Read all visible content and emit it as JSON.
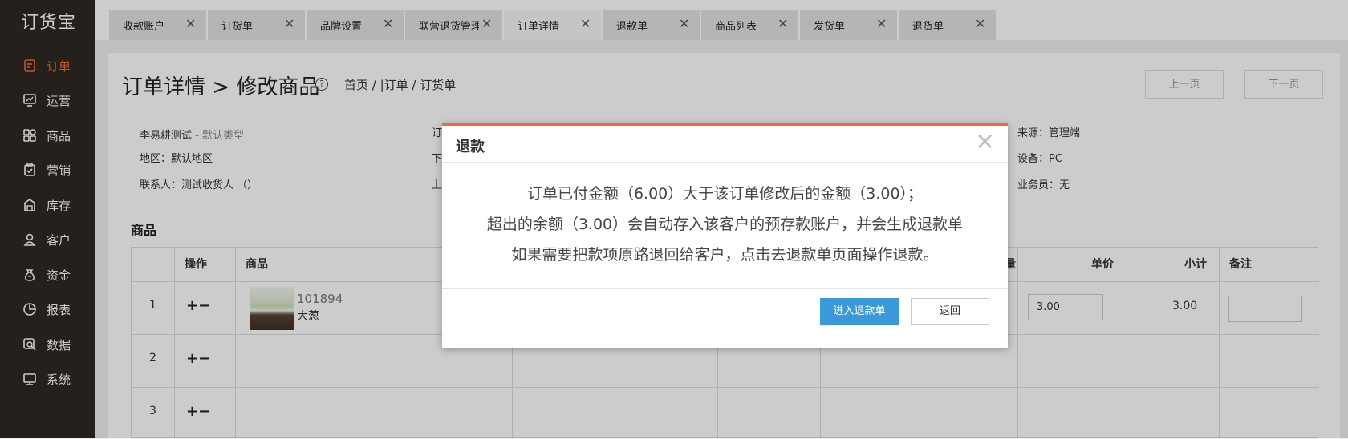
{
  "logo": "订货宝",
  "sidebar": {
    "items": [
      {
        "label": "订单",
        "icon": "order-icon"
      },
      {
        "label": "运营",
        "icon": "operations-icon"
      },
      {
        "label": "商品",
        "icon": "goods-icon"
      },
      {
        "label": "营销",
        "icon": "marketing-icon"
      },
      {
        "label": "库存",
        "icon": "warehouse-icon"
      },
      {
        "label": "客户",
        "icon": "customer-icon"
      },
      {
        "label": "资金",
        "icon": "money-bag-icon"
      },
      {
        "label": "报表",
        "icon": "pie-chart-icon"
      },
      {
        "label": "数据",
        "icon": "data-search-icon"
      },
      {
        "label": "系统",
        "icon": "monitor-icon"
      }
    ]
  },
  "tabs": [
    {
      "label": "收款账户"
    },
    {
      "label": "订货单"
    },
    {
      "label": "品牌设置"
    },
    {
      "label": "联营退货管理"
    },
    {
      "label": "订单详情"
    },
    {
      "label": "退款单"
    },
    {
      "label": "商品列表"
    },
    {
      "label": "发货单"
    },
    {
      "label": "退货单"
    }
  ],
  "page": {
    "title": "订单详情 > 修改商品",
    "help": "?",
    "breadcrumb": "首页 / |订单 / 订货单",
    "prev": "上一页",
    "next": "下一页"
  },
  "info": {
    "customer": "李易耕测试",
    "customer_type": " - 默认类型",
    "region": "地区：默认地区",
    "contact": "联系人：测试收货人 （）",
    "col2_1": "订",
    "col2_2": "下",
    "col2_3": "上",
    "source": "来源：管理端",
    "device": "设备：PC",
    "salesman": "业务员：无"
  },
  "goods": {
    "section_title": "商品",
    "headers": {
      "op": "操作",
      "goods": "商品",
      "qty_partial": "量",
      "price": "单价",
      "subtotal": "小计",
      "remark": "备注"
    },
    "rows": [
      {
        "no": "1",
        "ops": "+−",
        "code": "101894",
        "name": "大葱",
        "price": "3.00",
        "subtotal": "3.00"
      },
      {
        "no": "2",
        "ops": "+−"
      },
      {
        "no": "3",
        "ops": "+−"
      }
    ]
  },
  "dialog": {
    "title": "退款",
    "close": "×",
    "line1": "订单已付金额（6.00）大于该订单修改后的金额（3.00）；",
    "line2": "超出的余额（3.00）会自动存入该客户的预存款账户，并会生成退款单",
    "line3": "如果需要把款项原路退回给客户，点击去退款单页面操作退款。",
    "primary_button": "进入退款单",
    "back_button": "返回"
  },
  "colors": {
    "accent": "#f06a3c",
    "primary": "#3a9ad9",
    "sidebar": "#2f2824"
  }
}
